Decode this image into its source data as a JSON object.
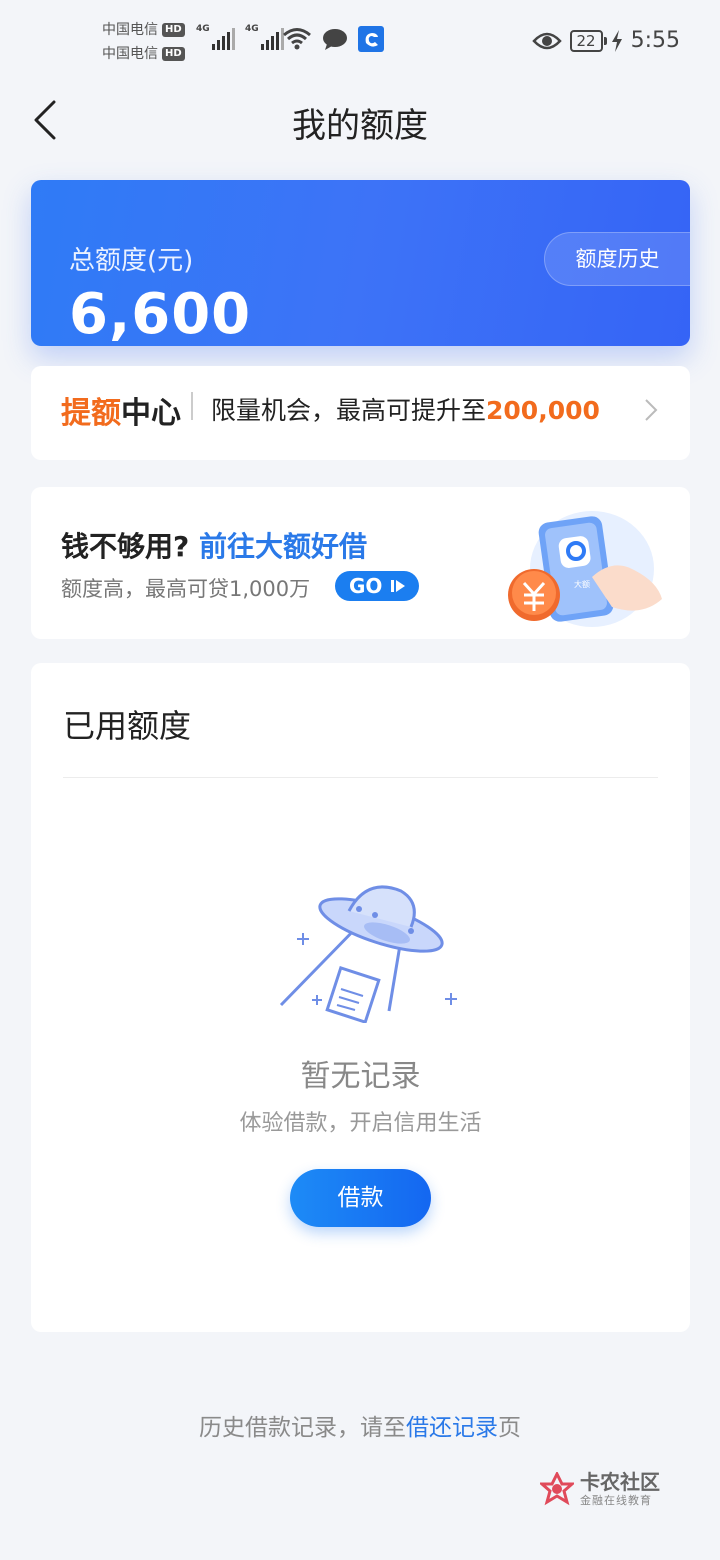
{
  "status_bar": {
    "carrier1": "中国电信",
    "carrier2": "中国电信",
    "hd_badge": "HD",
    "network1": "4G",
    "network2": "4G",
    "battery": "22",
    "time": "5:55"
  },
  "nav": {
    "title": "我的额度"
  },
  "quota_card": {
    "label": "总额度(元)",
    "value": "6,600",
    "history_button": "额度历史"
  },
  "raise_center": {
    "title_highlight": "提额",
    "title_rest": "中心",
    "text": "限量机会，最高可提升至",
    "amount": "200,000"
  },
  "promo": {
    "title_plain": "钱不够用?",
    "title_link": "前往大额好借",
    "subtitle": "额度高，最高可贷1,000万",
    "go_label": "GO",
    "art_label": "大额"
  },
  "used_quota": {
    "title": "已用额度",
    "empty_title": "暂无记录",
    "empty_subtitle": "体验借款，开启信用生活",
    "borrow_button": "借款"
  },
  "footer": {
    "text_before": "历史借款记录，请至",
    "link": "借还记录",
    "text_after": "页"
  },
  "watermark": {
    "main": "卡农社区",
    "sub": "金融在线教育"
  },
  "colors": {
    "accent_blue": "#2a79e8",
    "accent_orange": "#f26b1d",
    "card_blue": "#3d73f7"
  }
}
